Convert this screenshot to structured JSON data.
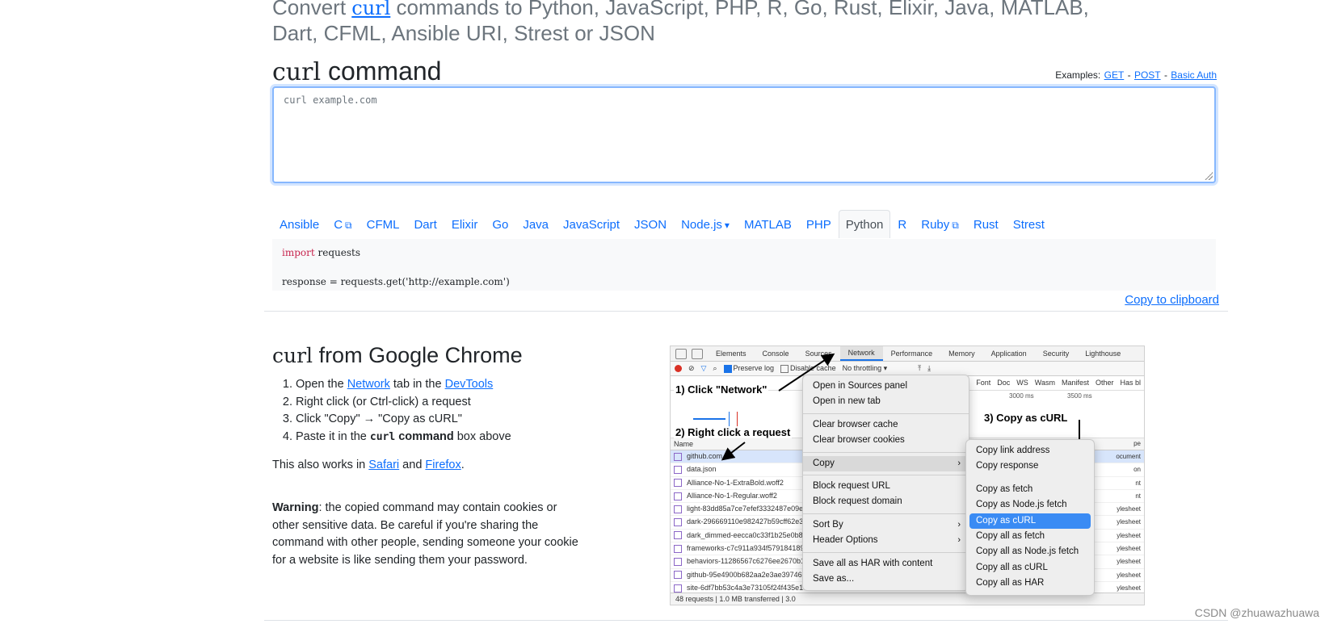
{
  "headline": {
    "prefix": "Convert ",
    "curl": "curl",
    "suffix": " commands to Python, JavaScript, PHP, R, Go, Rust, Elixir, Java, MATLAB, Dart, CFML, Ansible URI, Strest or JSON"
  },
  "command_section": {
    "heading_code": "curl",
    "heading_text": " command",
    "examples_label": "Examples:",
    "examples": [
      "GET",
      "POST",
      "Basic Auth"
    ],
    "input_placeholder": "curl example.com"
  },
  "languages": [
    {
      "label": "Ansible",
      "icon": ""
    },
    {
      "label": "C",
      "icon": "external-link-icon"
    },
    {
      "label": "CFML",
      "icon": ""
    },
    {
      "label": "Dart",
      "icon": ""
    },
    {
      "label": "Elixir",
      "icon": ""
    },
    {
      "label": "Go",
      "icon": ""
    },
    {
      "label": "Java",
      "icon": ""
    },
    {
      "label": "JavaScript",
      "icon": ""
    },
    {
      "label": "JSON",
      "icon": ""
    },
    {
      "label": "Node.js",
      "icon": "caret-down-icon"
    },
    {
      "label": "MATLAB",
      "icon": ""
    },
    {
      "label": "PHP",
      "icon": ""
    },
    {
      "label": "Python",
      "icon": "",
      "active": true
    },
    {
      "label": "R",
      "icon": ""
    },
    {
      "label": "Ruby",
      "icon": "external-link-icon"
    },
    {
      "label": "Rust",
      "icon": ""
    },
    {
      "label": "Strest",
      "icon": ""
    }
  ],
  "output": {
    "keyword": "import",
    "line1_rest": " requests",
    "line2": "response = requests.get('http://example.com')",
    "copy_label": "Copy to clipboard"
  },
  "chrome_section": {
    "heading_code": "curl",
    "heading_text": " from Google Chrome",
    "steps": [
      {
        "before": "Open the ",
        "link1": "Network",
        "middle": " tab in the ",
        "link2": "DevTools"
      },
      {
        "text": "Right click (or Ctrl-click) a request"
      },
      {
        "text": "Click \"Copy\" → \"Copy as cURL\""
      },
      {
        "before": "Paste it in the ",
        "bold_code": "curl",
        "bold_text": " command",
        "after": " box above"
      }
    ],
    "also": {
      "before": "This also works in ",
      "link1": "Safari",
      "middle": " and ",
      "link2": "Firefox",
      "after": "."
    },
    "warning": {
      "bold": "Warning",
      "text": ": the copied command may contain cookies or other sensitive data. Be careful if you're sharing the command with other people, sending someone your cookie for a website is like sending them your password."
    }
  },
  "devtools": {
    "tabs": [
      "Elements",
      "Console",
      "Sources",
      "Network",
      "Performance",
      "Memory",
      "Application",
      "Security",
      "Lighthouse"
    ],
    "selected_tab": "Network",
    "toolbar": {
      "preserve_log": "Preserve log",
      "disable_cache": "Disable cache",
      "throttling": "No throttling"
    },
    "filter_types": [
      "Font",
      "Doc",
      "WS",
      "Wasm",
      "Manifest",
      "Other",
      "Has bl"
    ],
    "timeline_ticks": [
      "3000 ms",
      "3500 ms"
    ],
    "column_name": "Name",
    "column_type": "pe",
    "requests": [
      {
        "name": "github.com",
        "type": "ocument"
      },
      {
        "name": "data.json",
        "type": "on"
      },
      {
        "name": "Alliance-No-1-ExtraBold.woff2",
        "type": "nt"
      },
      {
        "name": "Alliance-No-1-Regular.woff2",
        "type": "nt"
      },
      {
        "name": "light-83dd85a7ce7efef3332487e09e9",
        "type": "ylesheet"
      },
      {
        "name": "dark-296669110e982427b59cff62e3e",
        "type": "ylesheet"
      },
      {
        "name": "dark_dimmed-eecca0c33f1b25e0b8c",
        "type": "ylesheet"
      },
      {
        "name": "frameworks-c7c911a934f579184189b",
        "type": "ylesheet"
      },
      {
        "name": "behaviors-11286567c6276ee2670b1b",
        "type": "ylesheet"
      },
      {
        "name": "github-95e4900b682aa2e3ae397467c",
        "type": "ylesheet"
      },
      {
        "name": "site-6df7bb53c4a3e73105f24f435e19",
        "type": "ylesheet"
      }
    ],
    "status": "48 requests  |  1.0 MB transferred  |  3.0",
    "annotations": {
      "step1": "1) Click \"Network\"",
      "step2": "2) Right click a request",
      "step3": "3) Copy as cURL"
    },
    "context_menu": [
      {
        "label": "Open in Sources panel"
      },
      {
        "label": "Open in new tab"
      },
      {
        "sep": true
      },
      {
        "label": "Clear browser cache"
      },
      {
        "label": "Clear browser cookies"
      },
      {
        "sep": true
      },
      {
        "label": "Copy",
        "submenu": true,
        "active": true
      },
      {
        "sep": true
      },
      {
        "label": "Block request URL"
      },
      {
        "label": "Block request domain"
      },
      {
        "sep": true
      },
      {
        "label": "Sort By",
        "submenu": true
      },
      {
        "label": "Header Options",
        "submenu": true
      },
      {
        "sep": true
      },
      {
        "label": "Save all as HAR with content"
      },
      {
        "label": "Save as..."
      }
    ],
    "copy_submenu": [
      {
        "label": "Copy link address"
      },
      {
        "label": "Copy response"
      },
      {
        "gap": true
      },
      {
        "label": "Copy as fetch"
      },
      {
        "label": "Copy as Node.js fetch"
      },
      {
        "label": "Copy as cURL",
        "highlight": true
      },
      {
        "label": "Copy all as fetch"
      },
      {
        "label": "Copy all as Node.js fetch"
      },
      {
        "label": "Copy all as cURL"
      },
      {
        "label": "Copy all as HAR"
      }
    ]
  },
  "watermark": "CSDN @zhuawazhuawa",
  "colors": {
    "link": "#0d6efd",
    "focus_border": "#86b7fe",
    "menu_highlight": "#3a8bf4",
    "keyword": "#c7254e"
  }
}
